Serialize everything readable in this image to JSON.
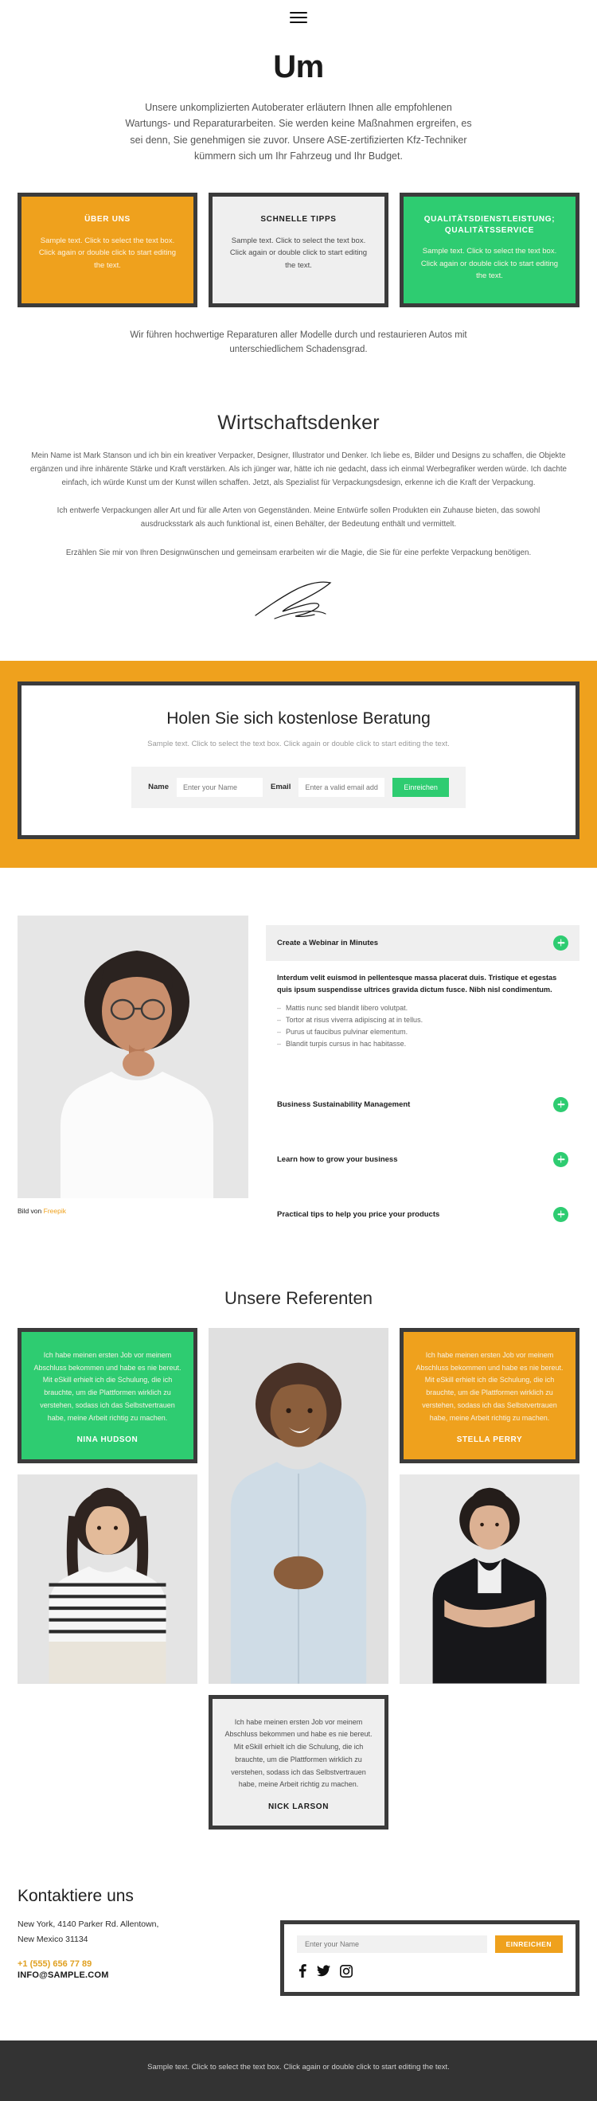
{
  "header": {
    "menu_icon": "hamburger-menu-icon"
  },
  "hero": {
    "title": "Um",
    "paragraph": "Unsere unkomplizierten Autoberater erläutern Ihnen alle empfohlenen Wartungs- und Reparaturarbeiten. Sie werden keine Maßnahmen ergreifen, es sei denn, Sie genehmigen sie zuvor. Unsere ASE-zertifizierten Kfz-Techniker kümmern sich um Ihr Fahrzeug und Ihr Budget."
  },
  "boxes": [
    {
      "title": "ÜBER UNS",
      "text": "Sample text. Click to select the text box. Click again or double click to start editing the text.",
      "color": "#efa11d",
      "style": "orange"
    },
    {
      "title": "SCHNELLE TIPPS",
      "text": "Sample text. Click to select the text box. Click again or double click to start editing the text.",
      "color": "#efefef",
      "style": "grey"
    },
    {
      "title": "QUALITÄTSDIENSTLEISTUNG; QUALITÄTSSERVICE",
      "text": "Sample text. Click to select the text box. Click again or double click to start editing the text.",
      "color": "#2ecc71",
      "style": "green"
    }
  ],
  "sub_note": "Wir führen hochwertige Reparaturen aller Modelle durch und restaurieren Autos mit unterschiedlichem Schadensgrad.",
  "bio": {
    "title": "Wirtschaftsdenker",
    "p1": "Mein Name ist Mark Stanson und ich bin ein kreativer Verpacker, Designer, Illustrator und Denker. Ich liebe es, Bilder und Designs zu schaffen, die Objekte ergänzen und ihre inhärente Stärke und Kraft verstärken. Als ich jünger war, hätte ich nie gedacht, dass ich einmal Werbegrafiker werden würde. Ich dachte einfach, ich würde Kunst um der Kunst willen schaffen. Jetzt, als Spezialist für Verpackungsdesign, erkenne ich die Kraft der Verpackung.",
    "p2": "Ich entwerfe Verpackungen aller Art und für alle Arten von Gegenständen. Meine Entwürfe sollen Produkten ein Zuhause bieten, das sowohl ausdrucksstark als auch funktional ist, einen Behälter, der Bedeutung enthält und vermittelt.",
    "p3": "Erzählen Sie mir von Ihren Designwünschen und gemeinsam erarbeiten wir die Magie, die Sie für eine perfekte Verpackung benötigen.",
    "signature_icon": "handwritten-signature"
  },
  "cta": {
    "title": "Holen Sie sich kostenlose Beratung",
    "subtitle": "Sample text. Click to select the text box. Click again or double click to start editing the text.",
    "name_label": "Name",
    "name_placeholder": "Enter your Name",
    "email_label": "Email",
    "email_placeholder": "Enter a valid email add",
    "submit_label": "Einreichen",
    "band_color": "#efa11d",
    "submit_color": "#2ecc71"
  },
  "feature": {
    "image_alt": "woman-thinking-photo",
    "credit_prefix": "Bild von",
    "credit_link": "Freepik",
    "accordion": [
      {
        "title": "Create a Webinar in Minutes",
        "open": true,
        "lead": "Interdum velit euismod in pellentesque massa placerat duis. Tristique et egestas quis ipsum suspendisse ultrices gravida dictum fusce. Nibh nisl condimentum.",
        "bullets": [
          "Mattis nunc sed blandit libero volutpat.",
          "Tortor at risus viverra adipiscing at in tellus.",
          "Purus ut faucibus pulvinar elementum.",
          "Blandit turpis cursus in hac habitasse."
        ]
      },
      {
        "title": "Business Sustainability Management",
        "open": false,
        "lead": "",
        "bullets": []
      },
      {
        "title": "Learn how to grow your business",
        "open": false,
        "lead": "",
        "bullets": []
      },
      {
        "title": "Practical tips to help you price your products",
        "open": false,
        "lead": "",
        "bullets": []
      }
    ]
  },
  "testimonials": {
    "title": "Unsere Referenten",
    "quote": "Ich habe meinen ersten Job vor meinem Abschluss bekommen und habe es nie bereut. Mit eSkill erhielt ich die Schulung, die ich brauchte, um die Plattformen wirklich zu verstehen, sodass ich das Selbstvertrauen habe, meine Arbeit richtig zu machen.",
    "cards": [
      {
        "name": "NINA HUDSON",
        "style": "green"
      },
      {
        "name": "STELLA PERRY",
        "style": "orange"
      },
      {
        "name": "NICK LARSON",
        "style": "light"
      }
    ],
    "photos": [
      "man-smiling-photo",
      "woman-striped-shirt-photo",
      "woman-black-dress-photo"
    ]
  },
  "contact": {
    "title": "Kontaktiere uns",
    "address_line1": "New York, 4140 Parker Rd. Allentown,",
    "address_line2": "New Mexico 31134",
    "phone": "+1 (555) 656 77 89",
    "email": "INFO@SAMPLE.COM",
    "name_placeholder": "Enter your Name",
    "submit_label": "EINREICHEN",
    "socials": [
      "facebook-icon",
      "twitter-icon",
      "instagram-icon"
    ]
  },
  "footer": {
    "text": "Sample text. Click to select the text box. Click again or double click to start editing the text."
  }
}
